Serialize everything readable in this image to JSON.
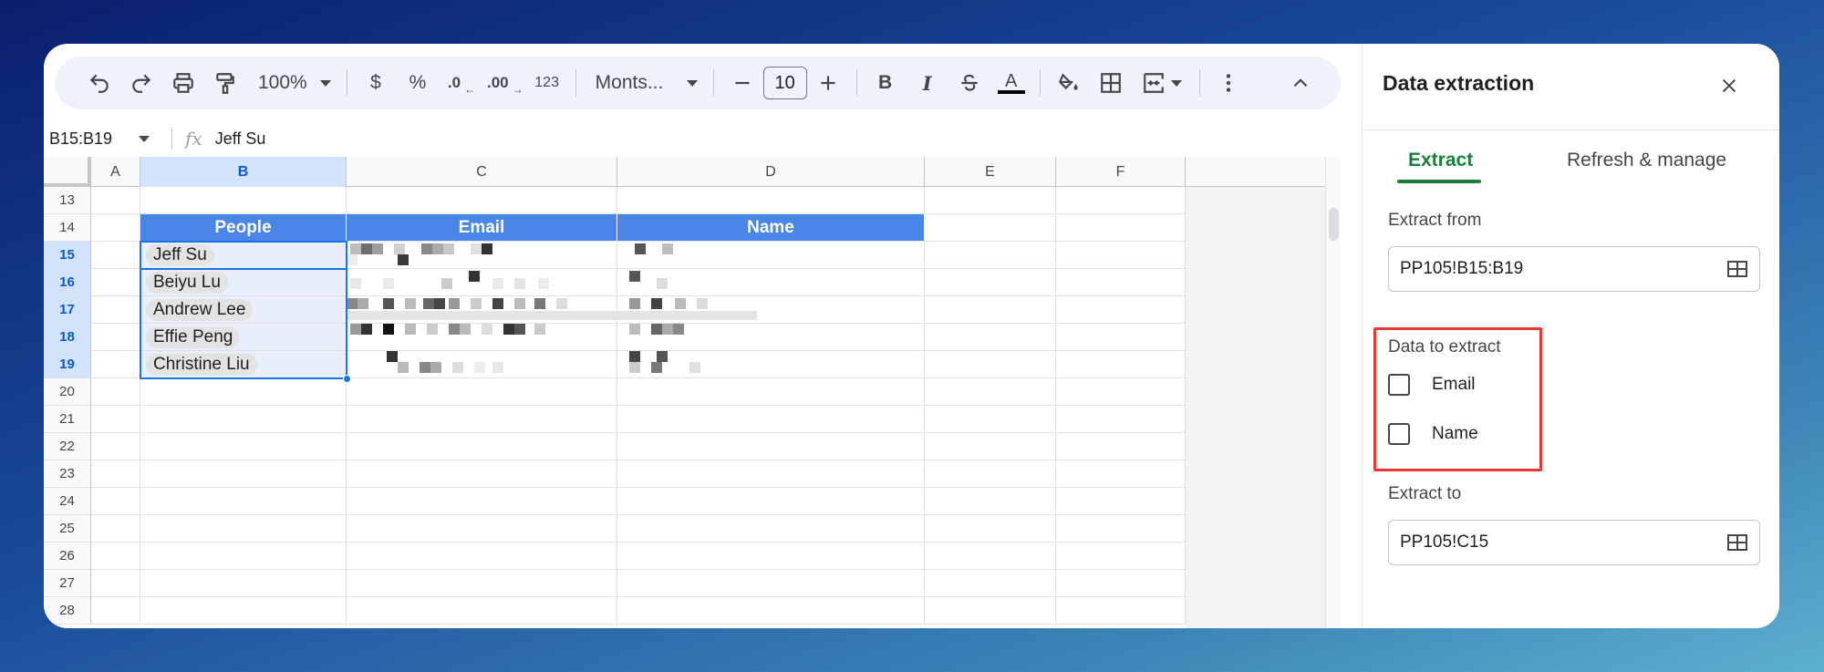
{
  "toolbar": {
    "zoom": "100%",
    "currency": "$",
    "percent": "%",
    "decrease_decimal": ".0",
    "increase_decimal": ".00",
    "number_format": "123",
    "font": "Monts...",
    "font_size": "10",
    "bold": "B",
    "italic": "I",
    "text_color_label": "A"
  },
  "formula_bar": {
    "cell_ref": "B15:B19",
    "content": "Jeff Su"
  },
  "grid": {
    "columns": [
      "A",
      "B",
      "C",
      "D",
      "E",
      "F"
    ],
    "rows": [
      "13",
      "14",
      "15",
      "16",
      "17",
      "18",
      "19",
      "20",
      "21",
      "22",
      "23",
      "24",
      "25",
      "26",
      "27",
      "28"
    ],
    "header_row": [
      "People",
      "Email",
      "Name"
    ],
    "people": [
      "Jeff Su",
      "Beiyu Lu",
      "Andrew Lee",
      "Effie Peng",
      "Christine Liu"
    ]
  },
  "panel": {
    "title": "Data extraction",
    "tabs": [
      "Extract",
      "Refresh & manage"
    ],
    "extract_from_label": "Extract from",
    "extract_from_value": "PP105!B15:B19",
    "data_to_extract_label": "Data to extract",
    "options": [
      "Email",
      "Name"
    ],
    "extract_to_label": "Extract to",
    "extract_to_value": "PP105!C15"
  }
}
